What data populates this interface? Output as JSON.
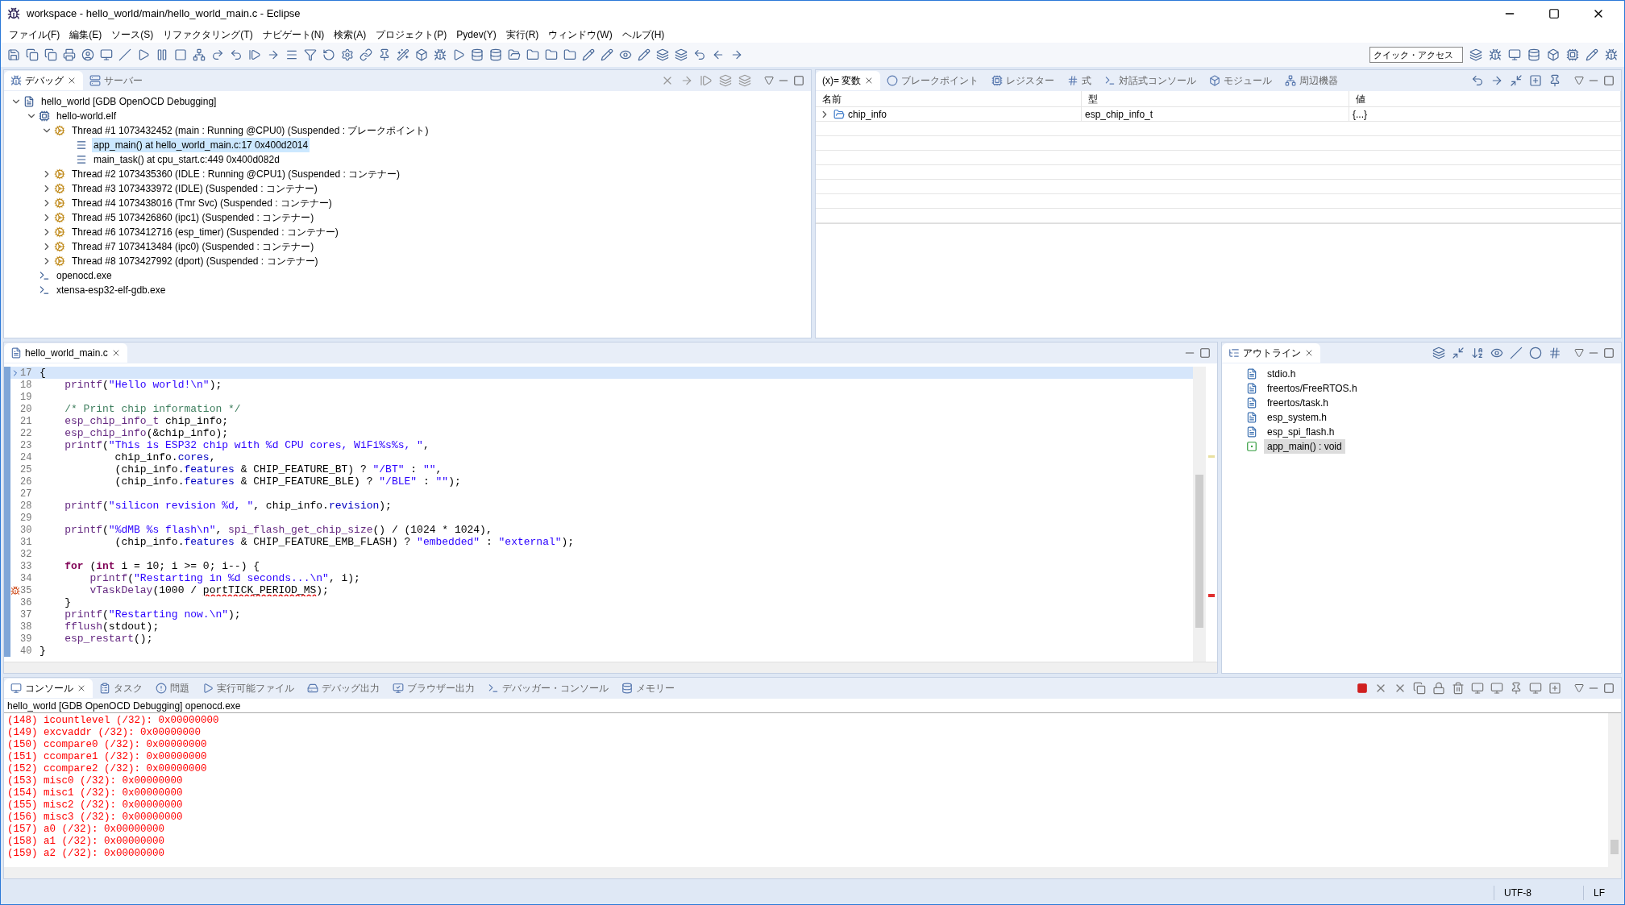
{
  "window": {
    "title": "workspace - hello_world/main/hello_world_main.c - Eclipse"
  },
  "menu": [
    "ファイル(F)",
    "編集(E)",
    "ソース(S)",
    "リファクタリング(T)",
    "ナビゲート(N)",
    "検索(A)",
    "プロジェクト(P)",
    "Pydev(Y)",
    "実行(R)",
    "ウィンドウ(W)",
    "ヘルプ(H)"
  ],
  "toolbar": {
    "quick_access": {
      "placeholder": "クイック・アクセス"
    }
  },
  "debug_view": {
    "tabs": [
      {
        "label": "デバッグ",
        "selected": true
      },
      {
        "label": "サーバー",
        "selected": false
      }
    ],
    "tree": [
      {
        "kind": "launch",
        "label": "hello_world [GDB OpenOCD Debugging]",
        "expanded": true,
        "children": [
          {
            "kind": "process",
            "label": "hello-world.elf",
            "expanded": true,
            "children": [
              {
                "kind": "thread",
                "label": "Thread #1 1073432452 (main : Running @CPU0) (Suspended : ブレークポイント)",
                "expanded": true,
                "children": [
                  {
                    "kind": "frame",
                    "label": "app_main() at hello_world_main.c:17 0x400d2014",
                    "selected": true
                  },
                  {
                    "kind": "frame",
                    "label": "main_task() at cpu_start.c:449 0x400d082d",
                    "selected": false
                  }
                ]
              },
              {
                "kind": "thread",
                "label": "Thread #2 1073435360 (IDLE : Running @CPU1) (Suspended : コンテナー)",
                "expanded": false
              },
              {
                "kind": "thread",
                "label": "Thread #3 1073433972 (IDLE) (Suspended : コンテナー)",
                "expanded": false
              },
              {
                "kind": "thread",
                "label": "Thread #4 1073438016 (Tmr Svc) (Suspended : コンテナー)",
                "expanded": false
              },
              {
                "kind": "thread",
                "label": "Thread #5 1073426860 (ipc1) (Suspended : コンテナー)",
                "expanded": false
              },
              {
                "kind": "thread",
                "label": "Thread #6 1073412716 (esp_timer) (Suspended : コンテナー)",
                "expanded": false
              },
              {
                "kind": "thread",
                "label": "Thread #7 1073413484 (ipc0) (Suspended : コンテナー)",
                "expanded": false
              },
              {
                "kind": "thread",
                "label": "Thread #8 1073427992 (dport) (Suspended : コンテナー)",
                "expanded": false
              }
            ]
          },
          {
            "kind": "exe",
            "label": "openocd.exe"
          },
          {
            "kind": "exe",
            "label": "xtensa-esp32-elf-gdb.exe"
          }
        ]
      }
    ]
  },
  "variables_view": {
    "tabs": [
      {
        "label": "(x)= 変数",
        "selected": true
      },
      {
        "label": "ブレークポイント",
        "selected": false
      },
      {
        "label": "レジスター",
        "selected": false
      },
      {
        "label": "式",
        "selected": false
      },
      {
        "label": "対話式コンソール",
        "selected": false
      },
      {
        "label": "モジュール",
        "selected": false
      },
      {
        "label": "周辺機器",
        "selected": false
      }
    ],
    "columns": [
      "名前",
      "型",
      "値"
    ],
    "rows": [
      {
        "cells": [
          "chip_info",
          "esp_chip_info_t",
          "{...}"
        ],
        "expanded": false
      }
    ]
  },
  "editor": {
    "tabs": [
      {
        "label": "hello_world_main.c",
        "selected": true
      }
    ],
    "lines": [
      {
        "number": "17",
        "current": true,
        "breakpoint": false,
        "tokens": [
          {
            "kind": "plain",
            "t": "{"
          }
        ]
      },
      {
        "number": "18",
        "current": false,
        "breakpoint": false,
        "tokens": [
          {
            "kind": "function",
            "t": "    printf"
          },
          {
            "kind": "plain",
            "t": "("
          },
          {
            "kind": "string",
            "t": "\"Hello world!\\n\""
          },
          {
            "kind": "plain",
            "t": ");"
          }
        ]
      },
      {
        "number": "19",
        "current": false,
        "breakpoint": false
      },
      {
        "number": "20",
        "current": false,
        "breakpoint": false,
        "tokens": [
          {
            "kind": "comment",
            "t": "    /* Print chip information */"
          }
        ]
      },
      {
        "number": "21",
        "current": false,
        "breakpoint": false,
        "tokens": [
          {
            "kind": "function",
            "t": "    esp_chip_info_t"
          },
          {
            "kind": "plain",
            "t": " chip_info;"
          }
        ]
      },
      {
        "number": "22",
        "current": false,
        "breakpoint": false,
        "tokens": [
          {
            "kind": "function",
            "t": "    esp_chip_info"
          },
          {
            "kind": "plain",
            "t": "(&chip_info);"
          }
        ]
      },
      {
        "number": "23",
        "current": false,
        "breakpoint": false,
        "tokens": [
          {
            "kind": "function",
            "t": "    printf"
          },
          {
            "kind": "plain",
            "t": "("
          },
          {
            "kind": "string",
            "t": "\"This is ESP32 chip with %d CPU cores, WiFi%s%s, \""
          },
          {
            "kind": "plain",
            "t": ","
          }
        ]
      },
      {
        "number": "24",
        "current": false,
        "breakpoint": false,
        "tokens": [
          {
            "kind": "plain",
            "t": "            chip_info."
          },
          {
            "kind": "field",
            "t": "cores"
          },
          {
            "kind": "plain",
            "t": ","
          }
        ]
      },
      {
        "number": "25",
        "current": false,
        "breakpoint": false,
        "tokens": [
          {
            "kind": "plain",
            "t": "            (chip_info."
          },
          {
            "kind": "field",
            "t": "features"
          },
          {
            "kind": "plain",
            "t": " & CHIP_FEATURE_BT) ? "
          },
          {
            "kind": "string",
            "t": "\"/BT\""
          },
          {
            "kind": "plain",
            "t": " : "
          },
          {
            "kind": "string",
            "t": "\"\""
          },
          {
            "kind": "plain",
            "t": ","
          }
        ]
      },
      {
        "number": "26",
        "current": false,
        "breakpoint": false,
        "tokens": [
          {
            "kind": "plain",
            "t": "            (chip_info."
          },
          {
            "kind": "field",
            "t": "features"
          },
          {
            "kind": "plain",
            "t": " & CHIP_FEATURE_BLE) ? "
          },
          {
            "kind": "string",
            "t": "\"/BLE\""
          },
          {
            "kind": "plain",
            "t": " : "
          },
          {
            "kind": "string",
            "t": "\"\""
          },
          {
            "kind": "plain",
            "t": ");"
          }
        ]
      },
      {
        "number": "27",
        "current": false,
        "breakpoint": false
      },
      {
        "number": "28",
        "current": false,
        "breakpoint": false,
        "tokens": [
          {
            "kind": "function",
            "t": "    printf"
          },
          {
            "kind": "plain",
            "t": "("
          },
          {
            "kind": "string",
            "t": "\"silicon revision %d, \""
          },
          {
            "kind": "plain",
            "t": ", chip_info."
          },
          {
            "kind": "field",
            "t": "revision"
          },
          {
            "kind": "plain",
            "t": ");"
          }
        ]
      },
      {
        "number": "29",
        "current": false,
        "breakpoint": false
      },
      {
        "number": "30",
        "current": false,
        "breakpoint": false,
        "tokens": [
          {
            "kind": "function",
            "t": "    printf"
          },
          {
            "kind": "plain",
            "t": "("
          },
          {
            "kind": "string",
            "t": "\"%dMB %s flash\\n\""
          },
          {
            "kind": "plain",
            "t": ", "
          },
          {
            "kind": "function",
            "t": "spi_flash_get_chip_size"
          },
          {
            "kind": "plain",
            "t": "() / (1024 * 1024),"
          }
        ]
      },
      {
        "number": "31",
        "current": false,
        "breakpoint": false,
        "tokens": [
          {
            "kind": "plain",
            "t": "            (chip_info."
          },
          {
            "kind": "field",
            "t": "features"
          },
          {
            "kind": "plain",
            "t": " & CHIP_FEATURE_EMB_FLASH) ? "
          },
          {
            "kind": "string",
            "t": "\"embedded\""
          },
          {
            "kind": "plain",
            "t": " : "
          },
          {
            "kind": "string",
            "t": "\"external\""
          },
          {
            "kind": "plain",
            "t": ");"
          }
        ]
      },
      {
        "number": "32",
        "current": false,
        "breakpoint": false
      },
      {
        "number": "33",
        "current": false,
        "breakpoint": false,
        "tokens": [
          {
            "kind": "keyword",
            "t": "    for"
          },
          {
            "kind": "plain",
            "t": " ("
          },
          {
            "kind": "keyword",
            "t": "int"
          },
          {
            "kind": "plain",
            "t": " i = 10; i >= 0; i--) {"
          }
        ]
      },
      {
        "number": "34",
        "current": false,
        "breakpoint": false,
        "tokens": [
          {
            "kind": "function",
            "t": "        printf"
          },
          {
            "kind": "plain",
            "t": "("
          },
          {
            "kind": "string",
            "t": "\"Restarting in %d seconds...\\n\""
          },
          {
            "kind": "plain",
            "t": ", i);"
          }
        ]
      },
      {
        "number": "35",
        "current": false,
        "breakpoint": true,
        "tokens": [
          {
            "kind": "function",
            "t": "        vTaskDelay"
          },
          {
            "kind": "plain",
            "t": "(1000 / "
          },
          {
            "kind": "error",
            "t": "portTICK_PERIOD_MS"
          },
          {
            "kind": "plain",
            "t": ");"
          }
        ]
      },
      {
        "number": "36",
        "current": false,
        "breakpoint": false,
        "tokens": [
          {
            "kind": "plain",
            "t": "    }"
          }
        ]
      },
      {
        "number": "37",
        "current": false,
        "breakpoint": false,
        "tokens": [
          {
            "kind": "function",
            "t": "    printf"
          },
          {
            "kind": "plain",
            "t": "("
          },
          {
            "kind": "string",
            "t": "\"Restarting now.\\n\""
          },
          {
            "kind": "plain",
            "t": ");"
          }
        ]
      },
      {
        "number": "38",
        "current": false,
        "breakpoint": false,
        "tokens": [
          {
            "kind": "function",
            "t": "    fflush"
          },
          {
            "kind": "plain",
            "t": "(stdout);"
          }
        ]
      },
      {
        "number": "39",
        "current": false,
        "breakpoint": false,
        "tokens": [
          {
            "kind": "function",
            "t": "    esp_restart"
          },
          {
            "kind": "plain",
            "t": "();"
          }
        ]
      },
      {
        "number": "40",
        "current": false,
        "breakpoint": false,
        "tokens": [
          {
            "kind": "plain",
            "t": "}"
          }
        ]
      }
    ]
  },
  "outline": {
    "tabs": [
      {
        "label": "アウトライン",
        "selected": true
      }
    ],
    "items": [
      {
        "kind": "include",
        "label": "stdio.h",
        "selected": false
      },
      {
        "kind": "include",
        "label": "freertos/FreeRTOS.h",
        "selected": false
      },
      {
        "kind": "include",
        "label": "freertos/task.h",
        "selected": false
      },
      {
        "kind": "include",
        "label": "esp_system.h",
        "selected": false
      },
      {
        "kind": "include",
        "label": "esp_spi_flash.h",
        "selected": false
      },
      {
        "kind": "function",
        "label": "app_main() : void",
        "selected": true
      }
    ]
  },
  "console": {
    "tabs": [
      {
        "label": "コンソール",
        "selected": true
      },
      {
        "label": "タスク",
        "selected": false
      },
      {
        "label": "問題",
        "selected": false
      },
      {
        "label": "実行可能ファイル",
        "selected": false
      },
      {
        "label": "デバッグ出力",
        "selected": false
      },
      {
        "label": "ブラウザー出力",
        "selected": false
      },
      {
        "label": "デバッガー・コンソール",
        "selected": false
      },
      {
        "label": "メモリー",
        "selected": false
      }
    ],
    "header": "hello_world [GDB OpenOCD Debugging] openocd.exe",
    "lines": [
      "(148) icountlevel (/32): 0x00000000",
      "(149) excvaddr (/32): 0x00000000",
      "(150) ccompare0 (/32): 0x00000000",
      "(151) ccompare1 (/32): 0x00000000",
      "(152) ccompare2 (/32): 0x00000000",
      "(153) misc0 (/32): 0x00000000",
      "(154) misc1 (/32): 0x00000000",
      "(155) misc2 (/32): 0x00000000",
      "(156) misc3 (/32): 0x00000000",
      "(157) a0 (/32): 0x00000000",
      "(158) a1 (/32): 0x00000000",
      "(159) a2 (/32): 0x00000000"
    ]
  },
  "status_bar": [
    "UTF-8",
    "LF"
  ]
}
